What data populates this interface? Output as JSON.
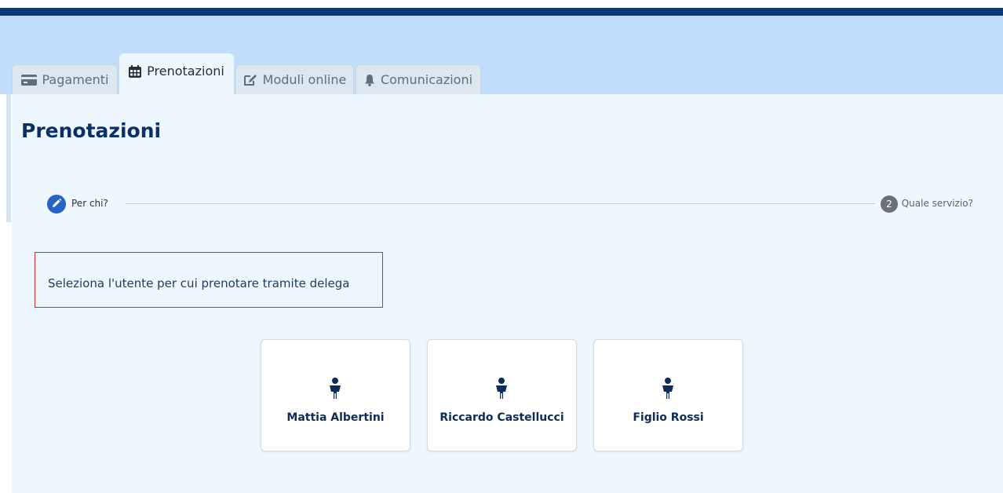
{
  "tabs": [
    {
      "label": "Pagamenti",
      "icon": "credit-card-icon"
    },
    {
      "label": "Prenotazioni",
      "icon": "calendar-icon",
      "active": true
    },
    {
      "label": "Moduli online",
      "icon": "edit-icon"
    },
    {
      "label": "Comunicazioni",
      "icon": "bell-icon"
    }
  ],
  "page": {
    "title": "Prenotazioni"
  },
  "stepper": {
    "step1": {
      "label": "Per chi?",
      "icon": "pencil-icon"
    },
    "step2": {
      "number": "2",
      "label": "Quale servizio?"
    }
  },
  "message": {
    "text": "Seleziona l'utente per cui prenotare tramite delega"
  },
  "users": [
    {
      "name": "Mattia Albertini",
      "icon": "person-icon"
    },
    {
      "name": "Riccardo Castellucci",
      "icon": "person-icon"
    },
    {
      "name": "Figlio Rossi",
      "icon": "person-icon"
    }
  ],
  "colors": {
    "top_bar": "#0b3a7a",
    "header_band": "#c0ddfb",
    "content_bg": "#eef6fe",
    "title": "#0b3066",
    "step_active": "#2563c8",
    "step_inactive": "#6c7179",
    "message_border": "#d22b2b"
  }
}
